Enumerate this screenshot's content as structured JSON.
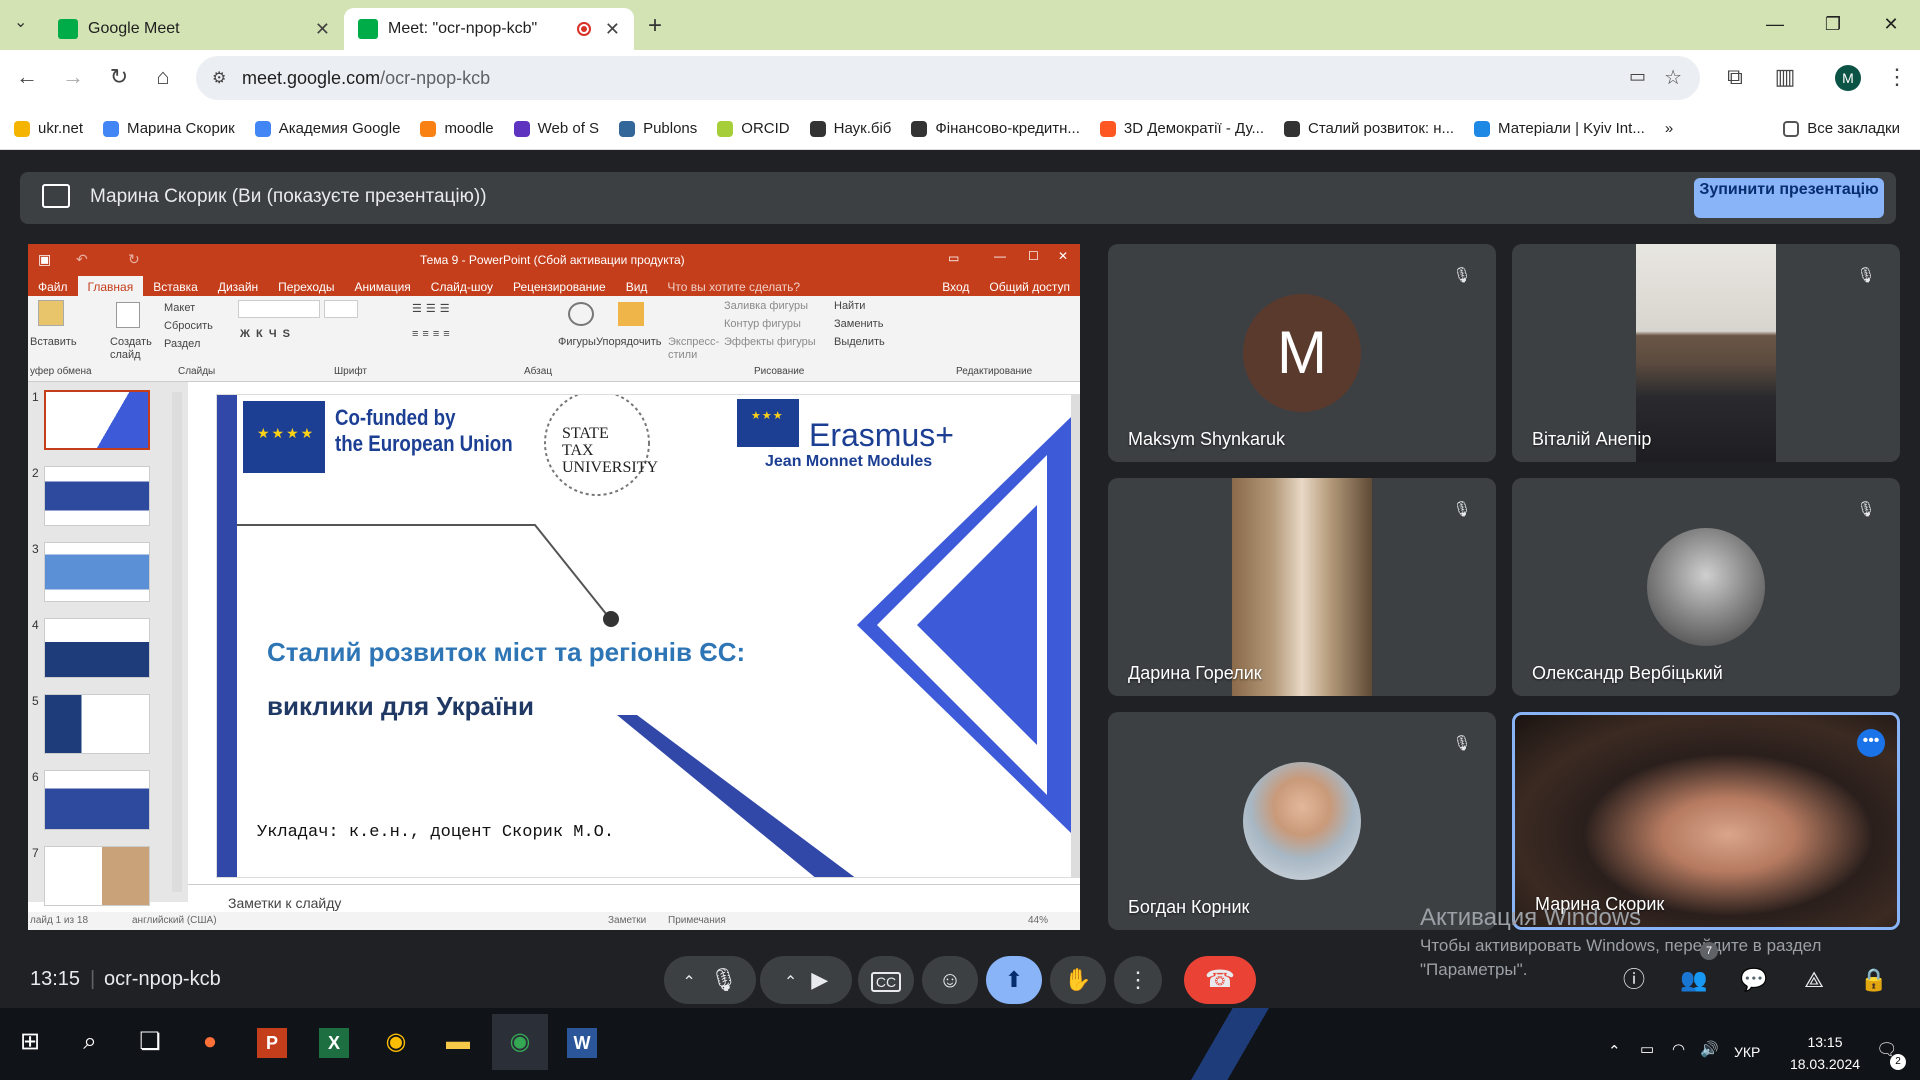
{
  "browser": {
    "tabs": [
      {
        "title": "Google Meet"
      },
      {
        "title": "Meet: \"осr-npop-kcb\""
      }
    ],
    "url_host": "meet.google.com",
    "url_path": "/ocr-npop-kcb",
    "profile_initial": "M",
    "bookmarks": [
      {
        "label": "ukr.net",
        "color": "#f4b400"
      },
      {
        "label": "Марина Скорик",
        "color": "#4285f4"
      },
      {
        "label": "Академия Google",
        "color": "#4285f4"
      },
      {
        "label": "moodle",
        "color": "#f98012"
      },
      {
        "label": "Web of S",
        "color": "#5e33bf"
      },
      {
        "label": "Publons",
        "color": "#336699"
      },
      {
        "label": "ORCID",
        "color": "#a6ce39"
      },
      {
        "label": "Наук.біб",
        "color": "#333333"
      },
      {
        "label": "Фінансово-кредитн...",
        "color": "#333333"
      },
      {
        "label": "3D Демократії - Ду...",
        "color": "#ff5722"
      },
      {
        "label": "Сталий розвиток: н...",
        "color": "#333333"
      },
      {
        "label": "Матеріали | Kyiv Int...",
        "color": "#1e88e5"
      }
    ],
    "all_bookmarks": "Все закладки"
  },
  "meet": {
    "presenting_text": "Марина Скорик (Ви (показуєте презентацію))",
    "stop_button": "Зупинити презентацію",
    "clock": "13:15",
    "meeting_code": "ocr-npop-kcb",
    "participant_count": "7",
    "participants": [
      {
        "name": "Maksym Shynkaruk",
        "initial": "M",
        "muted": true,
        "avatar_color": "#5b3a2e"
      },
      {
        "name": "Віталій Анепір",
        "muted": true
      },
      {
        "name": "Дарина Горелик",
        "muted": true
      },
      {
        "name": "Олександр Вербіцький",
        "muted": true
      },
      {
        "name": "Богдан Корник",
        "muted": true
      },
      {
        "name": "Марина Скорик",
        "muted": false
      }
    ]
  },
  "ppt": {
    "window_title": "Тема 9 - PowerPoint (Сбой активации продукта)",
    "signin": "Вход",
    "share": "Общий доступ",
    "tabs": [
      "Файл",
      "Главная",
      "Вставка",
      "Дизайн",
      "Переходы",
      "Анимация",
      "Слайд-шоу",
      "Рецензирование",
      "Вид"
    ],
    "tellme": "Что вы хотите сделать?",
    "ribbon_groups": [
      "уфер обмена",
      "Слайды",
      "Шрифт",
      "Абзац",
      "Рисование",
      "Редактирование"
    ],
    "ribbon_items": [
      "Вставить",
      "Создать слайд",
      "Макет",
      "Сбросить",
      "Раздел",
      "Фигуры",
      "Упорядочить",
      "Экспресс-стили",
      "Заливка фигуры",
      "Контур фигуры",
      "Эффекты фигуры",
      "Найти",
      "Заменить",
      "Выделить"
    ],
    "thumb_numbers": [
      "1",
      "2",
      "3",
      "4",
      "5",
      "6",
      "7"
    ],
    "notes_placeholder": "Заметки к слайду",
    "status_left": "лайд 1 из 18",
    "status_lang": "английский (США)",
    "status_notes": "Заметки",
    "status_comments": "Примечания",
    "zoom": "44%",
    "slide": {
      "cofunded_line1": "Co-funded by",
      "cofunded_line2": "the European Union",
      "stu_line1": "STATE",
      "stu_line2": "TAX",
      "stu_line3": "UNIVERSITY",
      "erasmus": "Erasmus+",
      "jean_monnet": "Jean Monnet Modules",
      "title_line1": "Сталий  розвиток міст та регіонів ЄС:",
      "title_line2": "виклики для  України",
      "author": "Укладач: к.е.н., доцент Скорик М.О."
    }
  },
  "windows_activation": {
    "title": "Активация Windows",
    "line1": "Чтобы активировать Windows, перейдите в раздел",
    "line2": "\"Параметры\"."
  },
  "taskbar": {
    "language": "УКР",
    "time": "13:15",
    "date": "18.03.2024",
    "notifications": "2"
  },
  "colors": {
    "accent_blue": "#8ab4f8",
    "end_call_red": "#ea4335",
    "ppt_orange": "#c43e1c",
    "slide_blue": "#3d5bd9",
    "eu_blue": "#1c3f94"
  }
}
